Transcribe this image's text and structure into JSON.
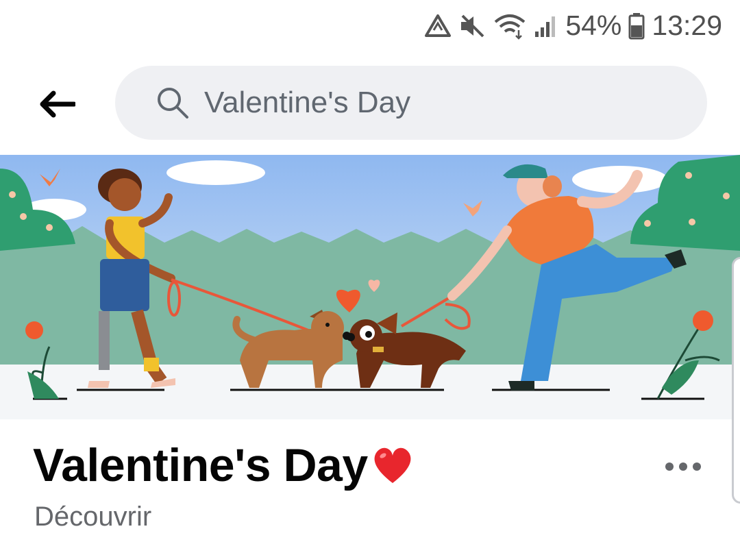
{
  "status_bar": {
    "battery_percent": "54%",
    "time": "13:29",
    "icons": [
      "recycle-notification-icon",
      "mute-icon",
      "wifi-icon",
      "cell-signal-icon",
      "battery-icon"
    ]
  },
  "search": {
    "value": "Valentine's Day",
    "placeholder": "Search"
  },
  "group": {
    "title": "Valentine's Day",
    "title_emoji": "heart-emoji-icon",
    "subtitle": "Découvrir"
  },
  "colors": {
    "search_bg": "#eff0f3",
    "title": "#050505",
    "secondary_text": "#65676b",
    "heart": "#e8262d",
    "sky": "#a9c9f5",
    "hills": "#7fb8a3"
  }
}
